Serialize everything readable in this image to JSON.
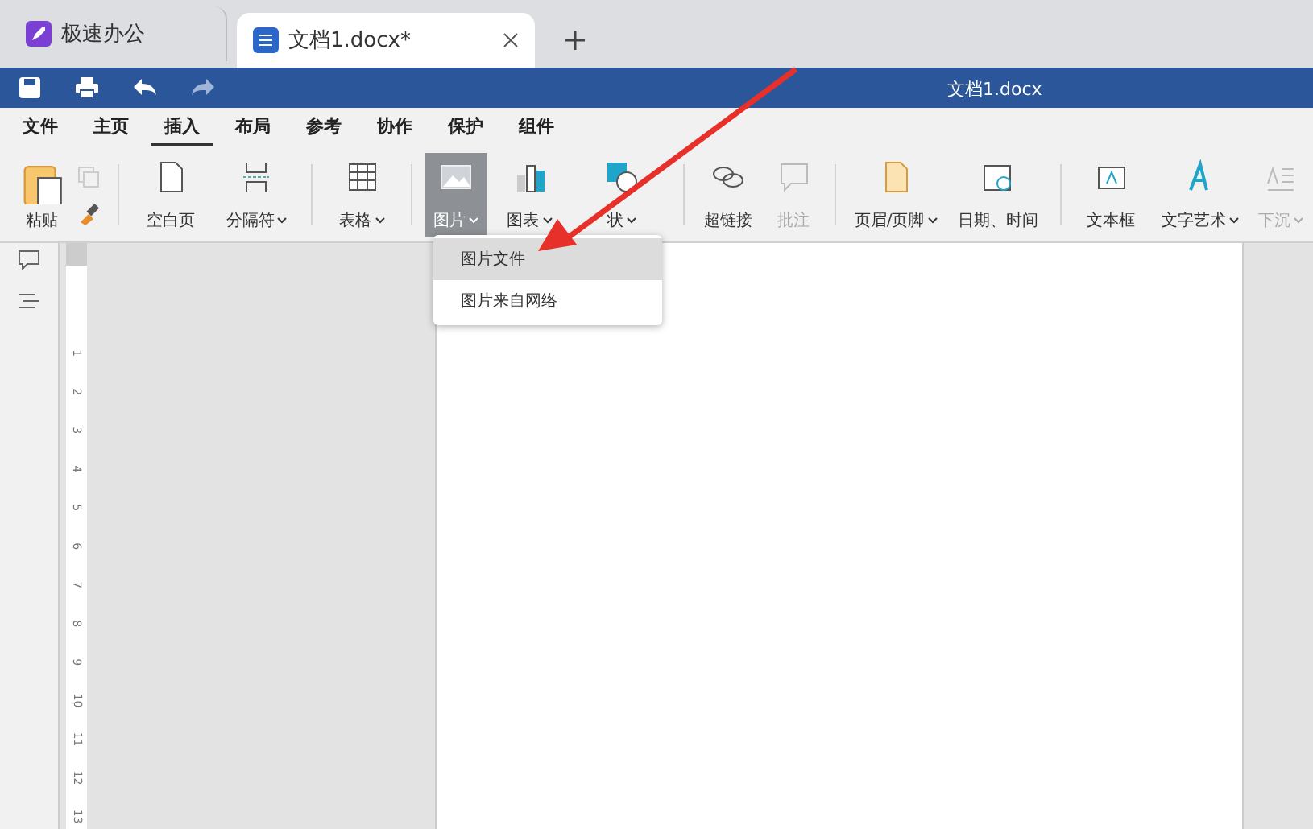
{
  "tabs": [
    {
      "label": "极速办公",
      "kind": "app",
      "selected": false
    },
    {
      "label": "文档1.docx*",
      "kind": "doc",
      "selected": true
    }
  ],
  "window": {
    "title": "文档1.docx"
  },
  "menu": [
    {
      "label": "文件",
      "selected": false
    },
    {
      "label": "主页",
      "selected": false
    },
    {
      "label": "插入",
      "selected": true
    },
    {
      "label": "布局",
      "selected": false
    },
    {
      "label": "参考",
      "selected": false
    },
    {
      "label": "协作",
      "selected": false
    },
    {
      "label": "保护",
      "selected": false
    },
    {
      "label": "组件",
      "selected": false
    }
  ],
  "ribbon": [
    {
      "kind": "paste",
      "label": "粘贴",
      "disabled": false,
      "dropdown": false,
      "selected": false
    },
    {
      "kind": "small",
      "disabled": true
    },
    {
      "kind": "divider"
    },
    {
      "kind": "page",
      "label": "空白页",
      "disabled": false,
      "dropdown": false,
      "selected": false
    },
    {
      "kind": "break",
      "label": "分隔符",
      "disabled": false,
      "dropdown": true,
      "selected": false
    },
    {
      "kind": "divider"
    },
    {
      "kind": "table",
      "label": "表格",
      "disabled": false,
      "dropdown": true,
      "selected": false
    },
    {
      "kind": "divider"
    },
    {
      "kind": "image",
      "label": "图片",
      "disabled": false,
      "dropdown": true,
      "selected": true
    },
    {
      "kind": "chart",
      "label": "图表",
      "disabled": false,
      "dropdown": true,
      "selected": false
    },
    {
      "kind": "shape",
      "label": "状",
      "disabled": false,
      "dropdown": true,
      "selected": false
    },
    {
      "kind": "divider"
    },
    {
      "kind": "link",
      "label": "超链接",
      "disabled": false,
      "dropdown": false,
      "selected": false
    },
    {
      "kind": "comment",
      "label": "批注",
      "disabled": true,
      "dropdown": false,
      "selected": false
    },
    {
      "kind": "divider"
    },
    {
      "kind": "header",
      "label": "页眉/页脚",
      "disabled": false,
      "dropdown": true,
      "selected": false
    },
    {
      "kind": "date",
      "label": "日期、时间",
      "disabled": false,
      "dropdown": false,
      "selected": false
    },
    {
      "kind": "divider"
    },
    {
      "kind": "textbox",
      "label": "文本框",
      "disabled": false,
      "dropdown": false,
      "selected": false
    },
    {
      "kind": "art",
      "label": "文字艺术",
      "disabled": false,
      "dropdown": true,
      "selected": false
    },
    {
      "kind": "dropcap",
      "label": "下沉",
      "disabled": true,
      "dropdown": true,
      "selected": false
    }
  ],
  "dropdown": [
    {
      "label": "图片文件",
      "selected": true
    },
    {
      "label": "图片来自网络",
      "selected": false
    }
  ],
  "ruler": [
    "1",
    "2",
    "3",
    "4",
    "5",
    "6",
    "7",
    "8",
    "9",
    "10",
    "11",
    "12",
    "13"
  ]
}
